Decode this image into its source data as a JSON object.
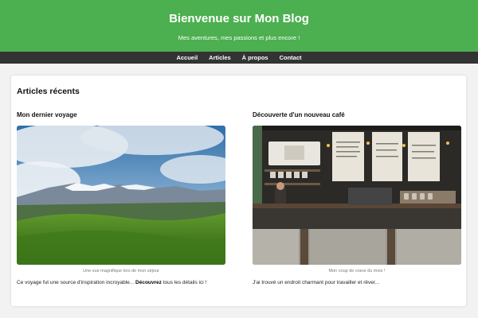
{
  "header": {
    "title": "Bienvenue sur Mon Blog",
    "subtitle": "Mes aventures, mes passions et plus encore !"
  },
  "nav": {
    "items": [
      "Accueil",
      "Articles",
      "À propos",
      "Contact"
    ]
  },
  "main": {
    "section_title": "Articles récents",
    "articles": [
      {
        "title": "Mon dernier voyage",
        "caption": "Une vue magnifique lors de mon séjour",
        "excerpt_start": "Ce voyage fut une source d'inspiration incroyable... ",
        "link": "Découvrez",
        "excerpt_end": " tous les détails ici !"
      },
      {
        "title": "Découverte d'un nouveau café",
        "caption": "Mon coup de coeur du mois !",
        "excerpt_start": "J'ai trouvé un endroit charmant pour travailler et rêver..."
      }
    ]
  },
  "colors": {
    "header_bg": "#4caf50",
    "nav_bg": "#333333",
    "page_bg": "#f2f2f2"
  }
}
